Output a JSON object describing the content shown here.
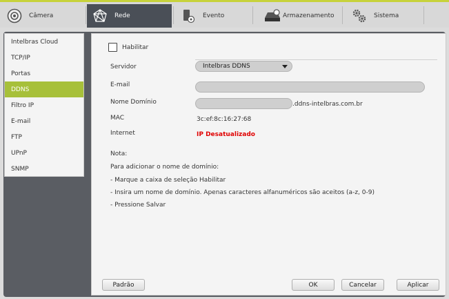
{
  "tabs": [
    {
      "label": "Câmera",
      "icon": "camera-icon"
    },
    {
      "label": "Rede",
      "icon": "network-icon"
    },
    {
      "label": "Evento",
      "icon": "event-icon"
    },
    {
      "label": "Armazenamento",
      "icon": "storage-icon"
    },
    {
      "label": "Sistema",
      "icon": "gear-icon"
    }
  ],
  "sidebar": {
    "items": [
      {
        "label": "Intelbras Cloud"
      },
      {
        "label": "TCP/IP"
      },
      {
        "label": "Portas"
      },
      {
        "label": "DDNS"
      },
      {
        "label": "Filtro IP"
      },
      {
        "label": "E-mail"
      },
      {
        "label": "FTP"
      },
      {
        "label": "UPnP"
      },
      {
        "label": "SNMP"
      }
    ]
  },
  "form": {
    "enable_label": "Habilitar",
    "enable_checked": false,
    "server_label": "Servidor",
    "server_value": "Intelbras DDNS",
    "email_label": "E-mail",
    "email_value": "",
    "domain_label": "Nome Domínio",
    "domain_value": "",
    "domain_suffix": ".ddns-intelbras.com.br",
    "mac_label": "MAC",
    "mac_value": "3c:ef:8c:16:27:68",
    "internet_label": "Internet",
    "internet_value": "IP Desatualizado",
    "internet_color": "#e00000"
  },
  "notes": {
    "title": "Nota:",
    "lines": [
      "Para adicionar o nome de domínio:",
      "- Marque a caixa de seleção Habilitar",
      "- Insira um nome de domínio. Apenas caracteres alfanuméricos são aceitos (a-z, 0-9)",
      "- Pressione Salvar"
    ]
  },
  "buttons": {
    "default": "Padrão",
    "ok": "OK",
    "cancel": "Cancelar",
    "apply": "Aplicar"
  },
  "colors": {
    "accent": "#a7c03a",
    "active_tab": "#4a4f57"
  }
}
